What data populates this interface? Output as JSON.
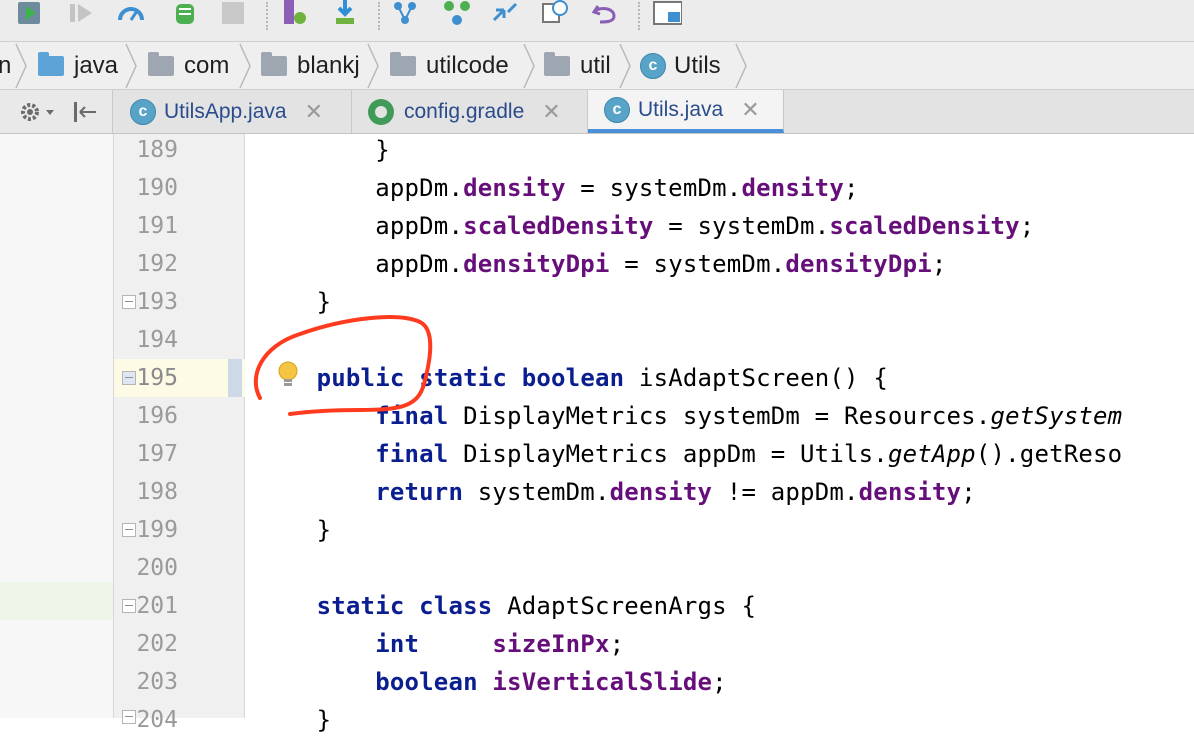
{
  "toolbar": {
    "icons": [
      "run-icon",
      "run-disabled-icon",
      "profiler-icon",
      "debug-android-icon",
      "stop-icon",
      "sync-android-icon",
      "sdk-download-icon",
      "vcs-branch-icon",
      "vcs-merge-icon",
      "vcs-pull-icon",
      "history-icon",
      "undo-icon",
      "layout-icon"
    ]
  },
  "breadcrumb": {
    "items": [
      {
        "label": "n",
        "icon": "none"
      },
      {
        "label": "java",
        "icon": "folder-blue-icon"
      },
      {
        "label": "com",
        "icon": "folder-icon"
      },
      {
        "label": "blankj",
        "icon": "folder-icon"
      },
      {
        "label": "utilcode",
        "icon": "folder-icon"
      },
      {
        "label": "util",
        "icon": "folder-icon"
      },
      {
        "label": "Utils",
        "icon": "class-icon"
      }
    ]
  },
  "tabs": {
    "items": [
      {
        "label": "UtilsApp.java",
        "icon": "class-icon",
        "close": "✕"
      },
      {
        "label": "config.gradle",
        "icon": "gradle-icon",
        "close": "✕"
      },
      {
        "label": "Utils.java",
        "icon": "class-icon",
        "close": "✕",
        "active": true
      }
    ],
    "class_badge": "c"
  },
  "gutter": {
    "line_numbers": [
      "189",
      "190",
      "191",
      "192",
      "193",
      "194",
      "195",
      "196",
      "197",
      "198",
      "199",
      "200",
      "201",
      "202",
      "203",
      "204"
    ],
    "current_line": "195"
  },
  "code": {
    "lines": [
      [
        {
          "t": "        }"
        }
      ],
      [
        {
          "t": "        appDm."
        },
        {
          "t": "density",
          "c": "fld"
        },
        {
          "t": " = systemDm."
        },
        {
          "t": "density",
          "c": "fld"
        },
        {
          "t": ";"
        }
      ],
      [
        {
          "t": "        appDm."
        },
        {
          "t": "scaledDensity",
          "c": "fld"
        },
        {
          "t": " = systemDm."
        },
        {
          "t": "scaledDensity",
          "c": "fld"
        },
        {
          "t": ";"
        }
      ],
      [
        {
          "t": "        appDm."
        },
        {
          "t": "densityDpi",
          "c": "fld"
        },
        {
          "t": " = systemDm."
        },
        {
          "t": "densityDpi",
          "c": "fld"
        },
        {
          "t": ";"
        }
      ],
      [
        {
          "t": "    }"
        }
      ],
      [
        {
          "t": ""
        }
      ],
      [
        {
          "t": "    "
        },
        {
          "t": "public",
          "c": "kw"
        },
        {
          "t": " "
        },
        {
          "t": "static",
          "c": "kw"
        },
        {
          "t": " "
        },
        {
          "t": "boolean",
          "c": "kw"
        },
        {
          "t": " isAdaptScreen() {"
        }
      ],
      [
        {
          "t": "        "
        },
        {
          "t": "final",
          "c": "kw"
        },
        {
          "t": " DisplayMetrics systemDm = Resources."
        },
        {
          "t": "getSystem",
          "c": "it"
        }
      ],
      [
        {
          "t": "        "
        },
        {
          "t": "final",
          "c": "kw"
        },
        {
          "t": " DisplayMetrics appDm = Utils."
        },
        {
          "t": "getApp",
          "c": "it"
        },
        {
          "t": "().getReso"
        }
      ],
      [
        {
          "t": "        "
        },
        {
          "t": "return",
          "c": "kw"
        },
        {
          "t": " systemDm."
        },
        {
          "t": "density",
          "c": "fld"
        },
        {
          "t": " != appDm."
        },
        {
          "t": "density",
          "c": "fld"
        },
        {
          "t": ";"
        }
      ],
      [
        {
          "t": "    }"
        }
      ],
      [
        {
          "t": ""
        }
      ],
      [
        {
          "t": "    "
        },
        {
          "t": "static",
          "c": "kw"
        },
        {
          "t": " "
        },
        {
          "t": "class",
          "c": "kw"
        },
        {
          "t": " AdaptScreenArgs {"
        }
      ],
      [
        {
          "t": "        "
        },
        {
          "t": "int",
          "c": "kw"
        },
        {
          "t": "     "
        },
        {
          "t": "sizeInPx",
          "c": "fld"
        },
        {
          "t": ";"
        }
      ],
      [
        {
          "t": "        "
        },
        {
          "t": "boolean",
          "c": "kw"
        },
        {
          "t": " "
        },
        {
          "t": "isVerticalSlide",
          "c": "fld"
        },
        {
          "t": ";"
        }
      ],
      [
        {
          "t": "    }"
        }
      ]
    ]
  },
  "colors": {
    "keyword": "#0b1e8f",
    "field": "#660e7a",
    "annotation": "#ff3b1f",
    "current_line": "#fdfbe6"
  }
}
